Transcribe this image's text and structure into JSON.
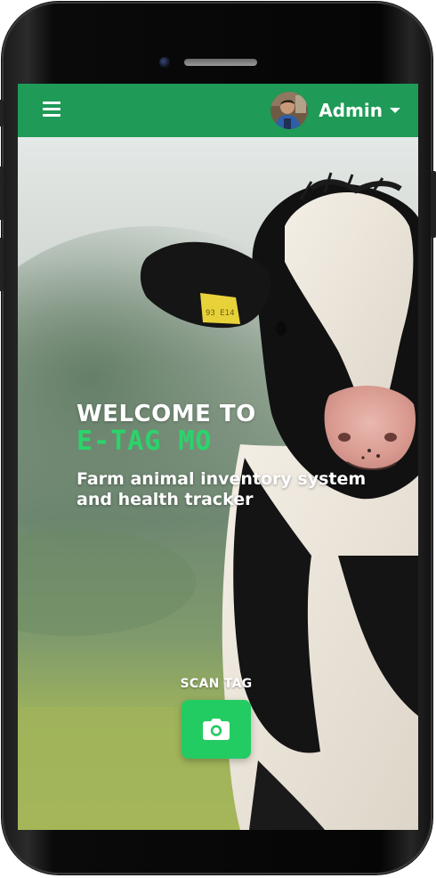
{
  "appbar": {
    "menu_icon": "hamburger-menu-icon",
    "user_name": "Admin",
    "dropdown_icon": "caret-down-icon",
    "background_color": "#1f9a57"
  },
  "hero": {
    "welcome_line": "WELCOME TO",
    "brand_name": "E-TAG MO",
    "tagline": "Farm animal inventory system and health tracker",
    "brand_color": "#2bd46b"
  },
  "scan": {
    "label": "SCAN TAG",
    "icon": "camera-icon",
    "button_color": "#22cc62"
  }
}
